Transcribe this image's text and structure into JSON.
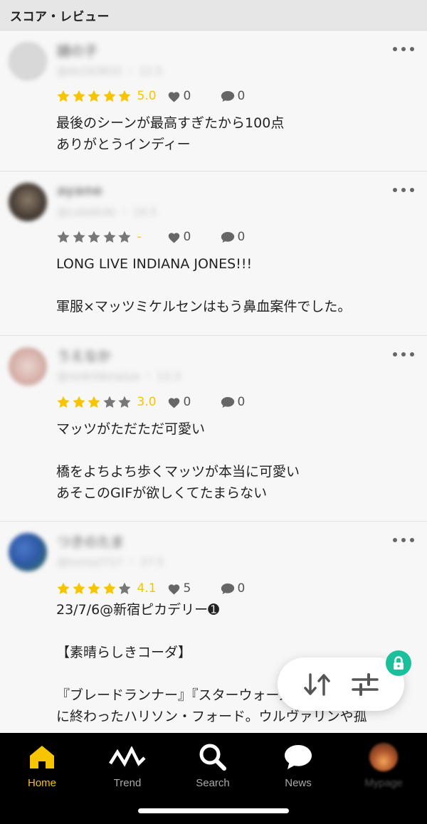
{
  "header": {
    "title": "スコア・レビュー"
  },
  "colors": {
    "accent": "#f7c500",
    "star_off": "#777777",
    "lock_badge": "#1bbf9b",
    "tabbar_bg": "#000000"
  },
  "reviews": [
    {
      "user_name": "謎の子",
      "user_meta": "@dx163833 ・ 12.5",
      "rating": 5.0,
      "score_text": "5.0",
      "likes": "0",
      "comments": "0",
      "text": "最後のシーンが最高すぎたから100点\nありがとうインディー"
    },
    {
      "user_name": "ayane",
      "user_meta": "@cutiekids ・ 14.5",
      "rating": 0,
      "score_text": "-",
      "likes": "0",
      "comments": "0",
      "text": "LONG LIVE INDIANA JONES!!!\n\n軍服×マッツミケルセンはもう鼻血案件でした。"
    },
    {
      "user_name": "うえなか",
      "user_meta": "@reokildenaiya ・ 13.3",
      "rating": 3.0,
      "score_text": "3.0",
      "likes": "0",
      "comments": "0",
      "text": "マッツがただただ可愛い\n\n橋をよちよち歩くマッツが本当に可愛い\nあそこのGIFが欲しくてたまらない"
    },
    {
      "user_name": "つきのたま",
      "user_meta": "@tuma2717 ・ 27.5",
      "rating": 4.1,
      "score_text": "4.1",
      "likes": "5",
      "comments": "0",
      "text": "23/7/6@新宿ピカデリー➊\n\n【素晴らしきコーダ】\n\n『ブレードランナー』『スターウォーズ』で死\nに終わったハリソン・フォード。ウルヴァリンや孤"
    }
  ],
  "tabs": [
    {
      "label": "Home",
      "icon": "home-icon",
      "active": true
    },
    {
      "label": "Trend",
      "icon": "trend-icon",
      "active": false
    },
    {
      "label": "Search",
      "icon": "search-icon",
      "active": false
    },
    {
      "label": "News",
      "icon": "news-icon",
      "active": false
    },
    {
      "label": "Mypage",
      "icon": "avatar-icon",
      "active": false
    }
  ],
  "fab": {
    "sort_icon": "sort-icon",
    "filter_icon": "filter-icon",
    "lock_icon": "lock-icon"
  }
}
